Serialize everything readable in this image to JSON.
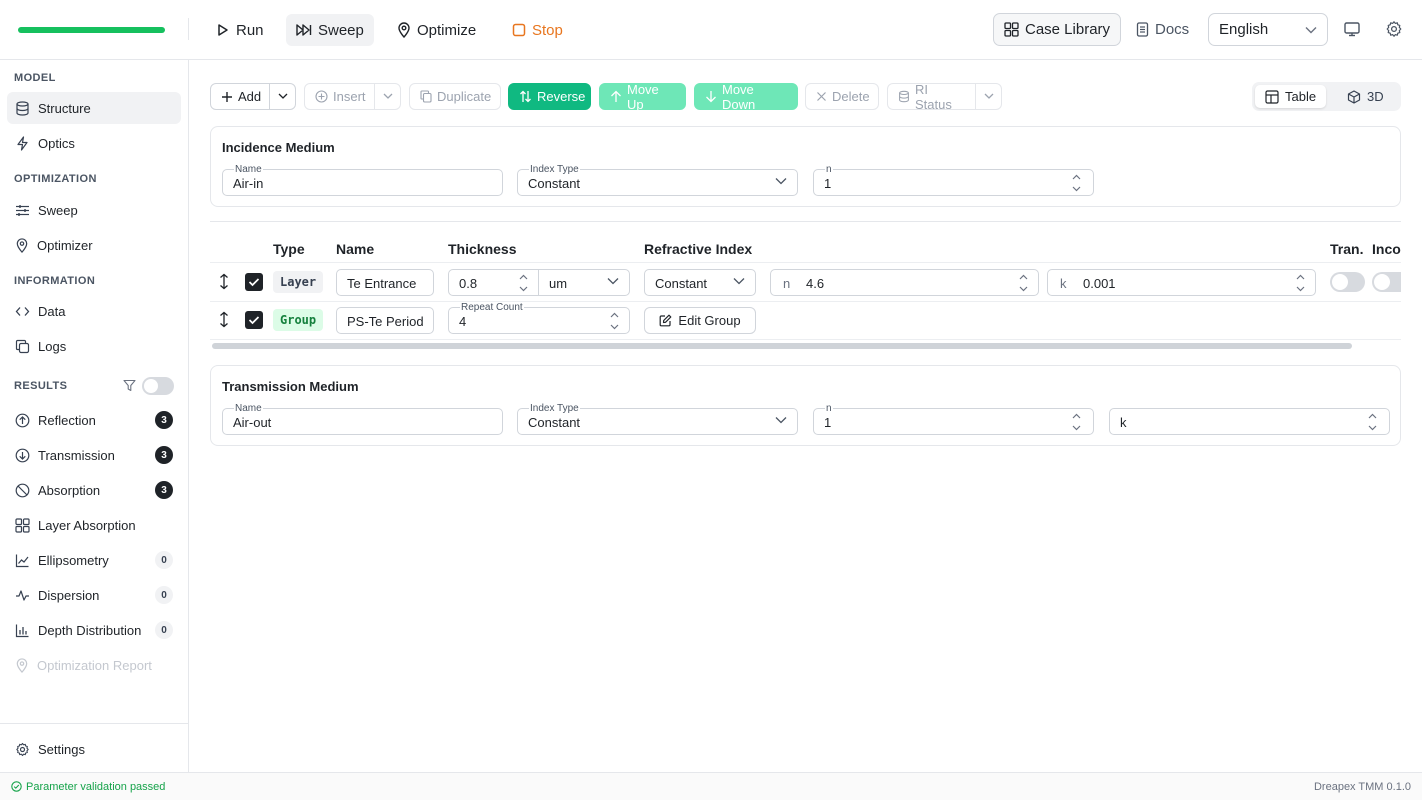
{
  "header": {
    "progress_pct": 100,
    "run_label": "Run",
    "sweep_label": "Sweep",
    "optimize_label": "Optimize",
    "stop_label": "Stop",
    "case_library_label": "Case Library",
    "docs_label": "Docs",
    "language_selected": "English"
  },
  "sidebar": {
    "sections": {
      "model": "MODEL",
      "optimization": "OPTIMIZATION",
      "information": "INFORMATION",
      "results": "RESULTS"
    },
    "items": {
      "structure": "Structure",
      "optics": "Optics",
      "sweep": "Sweep",
      "optimizer": "Optimizer",
      "data": "Data",
      "logs": "Logs",
      "reflection": "Reflection",
      "transmission": "Transmission",
      "absorption": "Absorption",
      "layer_absorption": "Layer Absorption",
      "ellipsometry": "Ellipsometry",
      "dispersion": "Dispersion",
      "depth_distribution": "Depth Distribution",
      "optimization_report": "Optimization Report",
      "settings": "Settings"
    },
    "badges": {
      "reflection": "3",
      "transmission": "3",
      "absorption": "3",
      "ellipsometry": "0",
      "dispersion": "0",
      "depth_distribution": "0"
    }
  },
  "toolbar": {
    "add": "Add",
    "insert": "Insert",
    "duplicate": "Duplicate",
    "reverse": "Reverse",
    "move_up": "Move Up",
    "move_down": "Move Down",
    "delete": "Delete",
    "ri_status": "RI Status",
    "view_table": "Table",
    "view_3d": "3D"
  },
  "incidence": {
    "title": "Incidence Medium",
    "name_label": "Name",
    "name_value": "Air-in",
    "index_type_label": "Index Type",
    "index_type_value": "Constant",
    "n_label": "n",
    "n_value": "1"
  },
  "table": {
    "headers": {
      "type": "Type",
      "name": "Name",
      "thickness": "Thickness",
      "refractive_index": "Refractive Index",
      "tran": "Tran.",
      "inco": "Inco"
    },
    "rows": [
      {
        "type": "Layer",
        "name": "Te Entrance",
        "thickness": "0.8",
        "unit": "um",
        "ri_type": "Constant",
        "n_prefix": "n",
        "n": "4.6",
        "k_prefix": "k",
        "k": "0.001",
        "checked": true
      },
      {
        "type": "Group",
        "name": "PS-Te Period",
        "repeat_label": "Repeat Count",
        "repeat": "4",
        "edit_label": "Edit Group",
        "checked": true
      }
    ]
  },
  "transmission_medium": {
    "title": "Transmission Medium",
    "name_label": "Name",
    "name_value": "Air-out",
    "index_type_label": "Index Type",
    "index_type_value": "Constant",
    "n_label": "n",
    "n_value": "1",
    "k_value": "k"
  },
  "status": {
    "message": "Parameter validation passed",
    "version": "Dreapex TMM 0.1.0"
  }
}
